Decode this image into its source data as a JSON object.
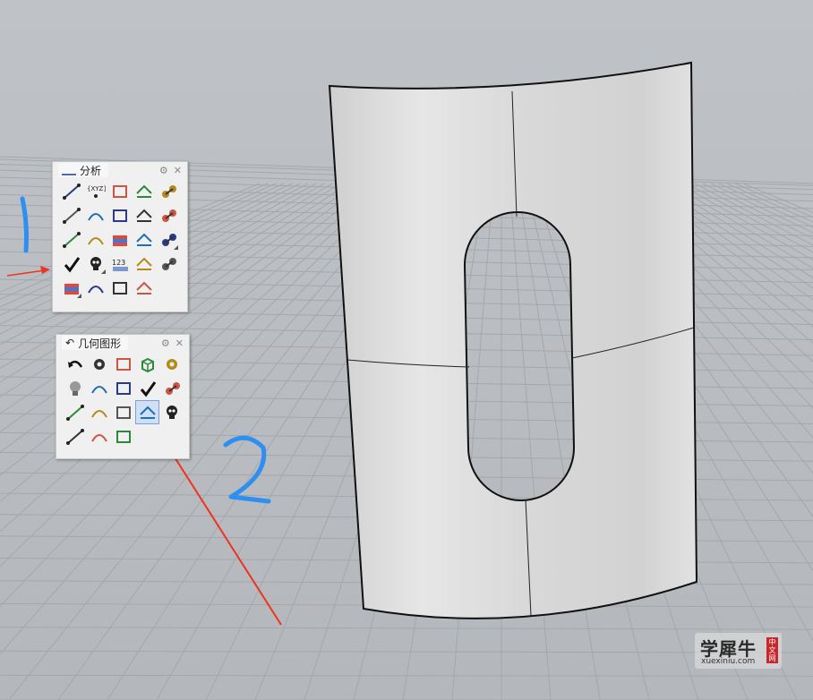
{
  "panels": {
    "analyze": {
      "title": "分析",
      "flyout_indices": [
        14,
        16,
        20
      ]
    },
    "geometry": {
      "title": "几何图形",
      "highlight_index": 13
    }
  },
  "annotations": {
    "label_1": "1",
    "label_2": "2",
    "arrow_color": "#ee3322",
    "label_color": "#2e8ff0"
  },
  "watermark": {
    "brand": "学犀牛",
    "site": "xuexiniu.com",
    "seal": [
      "中",
      "文",
      "网"
    ]
  },
  "colors": {
    "viewport_bg": "#b9bcc0",
    "grid_line": "#a4a7ab",
    "surface": "#dcdcdc",
    "panel_bg": "#f0f0f0"
  }
}
